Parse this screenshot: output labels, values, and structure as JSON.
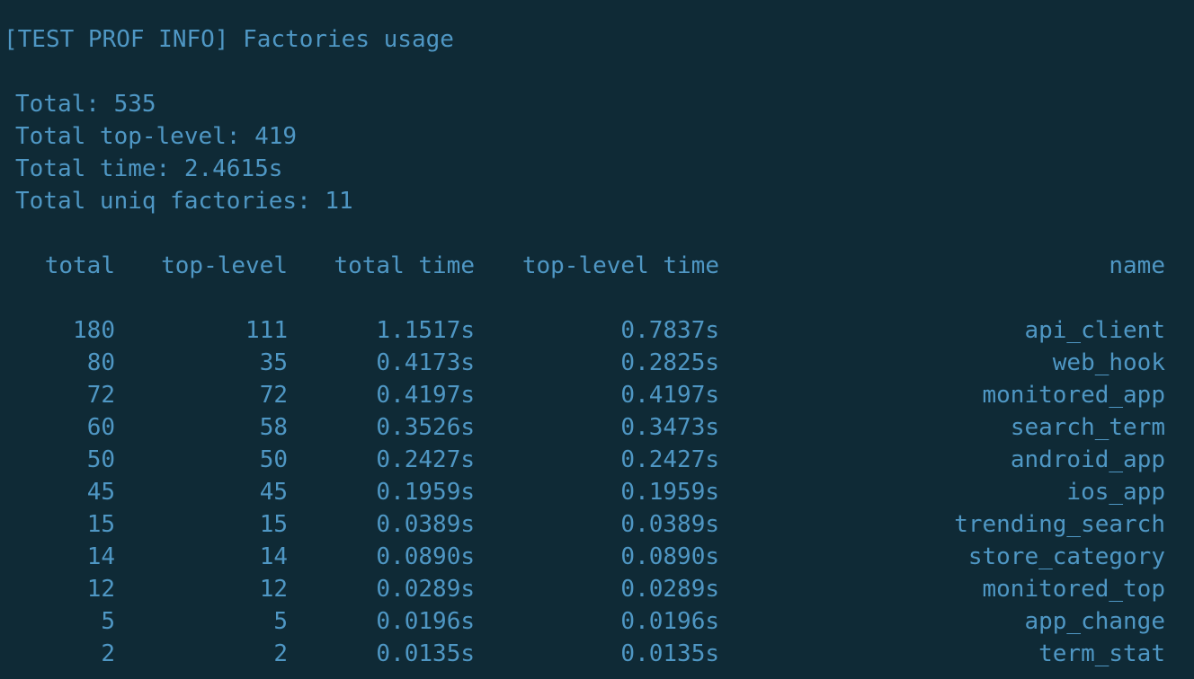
{
  "header": "[TEST PROF INFO] Factories usage",
  "stats": [
    "Total: 535",
    "Total top-level: 419",
    "Total time: 2.4615s",
    "Total uniq factories: 11"
  ],
  "table": {
    "columns": [
      "total",
      "top-level",
      "total time",
      "top-level time",
      "name"
    ],
    "rows": [
      [
        "180",
        "111",
        "1.1517s",
        "0.7837s",
        "api_client"
      ],
      [
        "80",
        "35",
        "0.4173s",
        "0.2825s",
        "web_hook"
      ],
      [
        "72",
        "72",
        "0.4197s",
        "0.4197s",
        "monitored_app"
      ],
      [
        "60",
        "58",
        "0.3526s",
        "0.3473s",
        "search_term"
      ],
      [
        "50",
        "50",
        "0.2427s",
        "0.2427s",
        "android_app"
      ],
      [
        "45",
        "45",
        "0.1959s",
        "0.1959s",
        "ios_app"
      ],
      [
        "15",
        "15",
        "0.0389s",
        "0.0389s",
        "trending_search"
      ],
      [
        "14",
        "14",
        "0.0890s",
        "0.0890s",
        "store_category"
      ],
      [
        "12",
        "12",
        "0.0289s",
        "0.0289s",
        "monitored_top"
      ],
      [
        "5",
        "5",
        "0.0196s",
        "0.0196s",
        "app_change"
      ],
      [
        "2",
        "2",
        "0.0135s",
        "0.0135s",
        "term_stat"
      ]
    ]
  },
  "colors": {
    "background": "#0f2a36",
    "text": "#4f97c4"
  }
}
